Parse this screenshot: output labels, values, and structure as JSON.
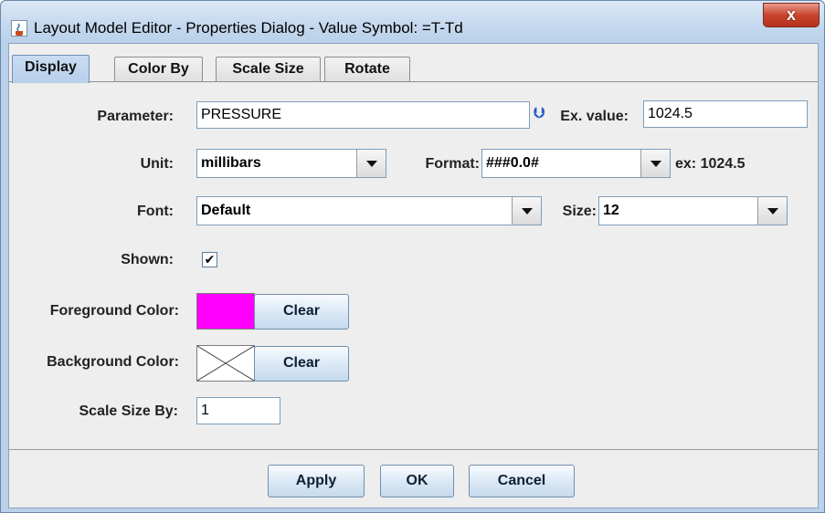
{
  "window": {
    "title": "Layout Model Editor - Properties Dialog - Value Symbol: =T-Td",
    "close_label": "x"
  },
  "tabs": [
    {
      "label": "Display",
      "active": true
    },
    {
      "label": "Color By",
      "active": false
    },
    {
      "label": "Scale Size",
      "active": false
    },
    {
      "label": "Rotate",
      "active": false
    }
  ],
  "display": {
    "parameter": {
      "label": "Parameter:",
      "value": "PRESSURE"
    },
    "ex_value": {
      "label": "Ex. value:",
      "value": "1024.5"
    },
    "unit": {
      "label": "Unit:",
      "value": "millibars"
    },
    "format": {
      "label": "Format:",
      "value": "###0.0#",
      "example": "ex: 1024.5"
    },
    "font": {
      "label": "Font:",
      "value": "Default"
    },
    "size": {
      "label": "Size:",
      "value": "12"
    },
    "shown": {
      "label": "Shown:",
      "checked": true,
      "mark": "✔"
    },
    "foreground": {
      "label": "Foreground Color:",
      "color": "#ff00ff",
      "clear_label": "Clear"
    },
    "background": {
      "label": "Background Color:",
      "color": "none",
      "clear_label": "Clear"
    },
    "scale_size_by": {
      "label": "Scale Size By:",
      "value": "1"
    }
  },
  "footer": {
    "apply_label": "Apply",
    "ok_label": "OK",
    "cancel_label": "Cancel"
  },
  "icons": {
    "app": "java-cup-icon",
    "parameter_expand": "double-chevron-down-icon"
  }
}
